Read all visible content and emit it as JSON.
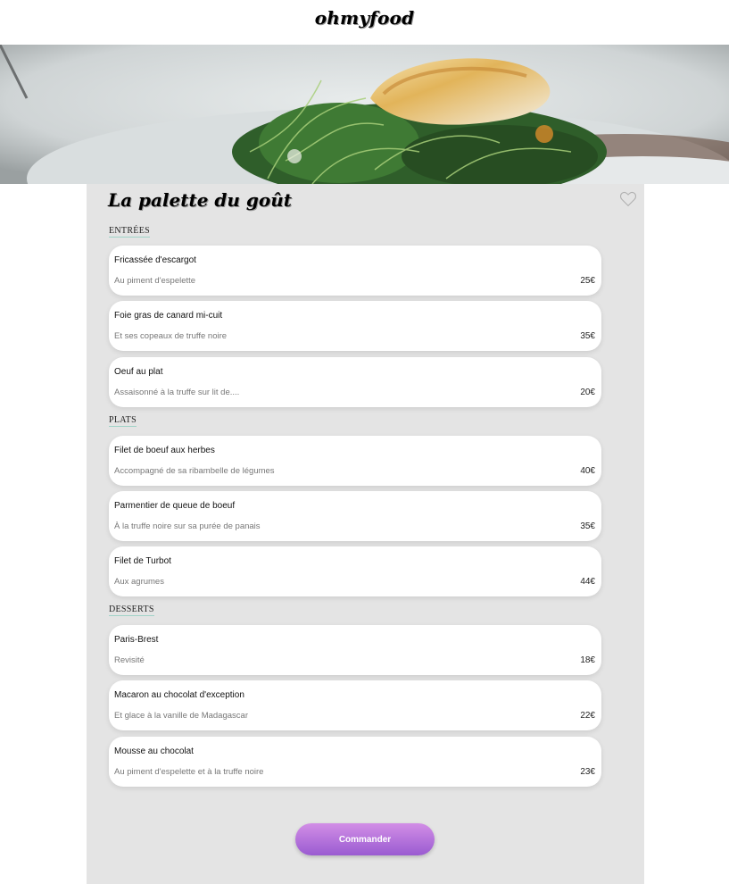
{
  "header": {
    "logo": "ohmyfood"
  },
  "hero": {
    "image": "plated-fish-with-greens-photo"
  },
  "restaurant": {
    "title": "La palette du goût"
  },
  "icons": {
    "favorite": "heart-outline-icon"
  },
  "sections": [
    {
      "label": "ENTRÉES",
      "items": [
        {
          "name": "Fricassée d'escargot",
          "desc": "Au piment d'espelette",
          "price": "25€"
        },
        {
          "name": "Foie gras de canard mi-cuit",
          "desc": "Et ses copeaux de truffe noire",
          "price": "35€"
        },
        {
          "name": "Oeuf au plat",
          "desc": "Assaisonné à la truffe sur lit de....",
          "price": "20€"
        }
      ]
    },
    {
      "label": "PLATS",
      "items": [
        {
          "name": "Filet de boeuf aux herbes",
          "desc": "Accompagné de sa ribambelle de légumes",
          "price": "40€"
        },
        {
          "name": "Parmentier de queue de boeuf",
          "desc": "À la truffe noire sur sa purée de panais",
          "price": "35€"
        },
        {
          "name": "Filet de Turbot",
          "desc": "Aux agrumes",
          "price": "44€"
        }
      ]
    },
    {
      "label": "DESSERTS",
      "items": [
        {
          "name": "Paris-Brest",
          "desc": "Revisité",
          "price": "18€"
        },
        {
          "name": "Macaron au chocolat d'exception",
          "desc": "Et glace à la vanille de Madagascar",
          "price": "22€"
        },
        {
          "name": "Mousse au chocolat",
          "desc": "Au piment d'espelette et à la truffe noire",
          "price": "23€"
        }
      ]
    }
  ],
  "order": {
    "label": "Commander"
  },
  "colors": {
    "card_bg": "#e4e4e4",
    "accent_start": "#d28ee6",
    "accent_end": "#9a5bd1",
    "underline": "#9fd3c7"
  }
}
